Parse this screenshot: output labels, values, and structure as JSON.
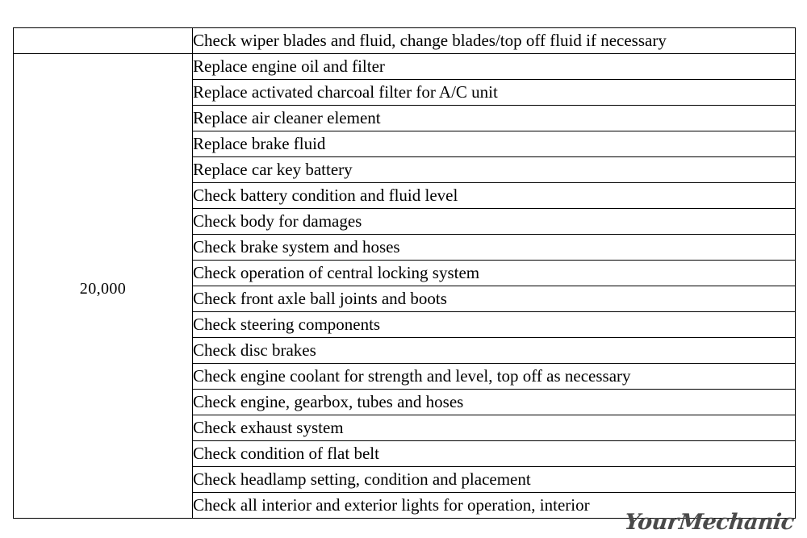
{
  "document": {
    "type": "maintenance-schedule-table",
    "background_color": "#ffffff",
    "border_color": "#000000",
    "text_color": "#000000"
  },
  "table": {
    "columns": [
      {
        "key": "mileage",
        "header": ""
      },
      {
        "key": "task",
        "header": ""
      }
    ],
    "groups": [
      {
        "mileage": "",
        "continued_from_previous": true,
        "tasks": [
          "Check wiper blades and fluid, change blades/top off fluid if necessary"
        ]
      },
      {
        "mileage": "20,000",
        "continued_from_previous": false,
        "tasks": [
          "Replace engine oil and filter",
          "Replace activated charcoal filter for A/C unit",
          "Replace air cleaner element",
          "Replace brake fluid",
          "Replace car key battery",
          "Check battery condition and fluid level",
          "Check body for damages",
          "Check brake system and hoses",
          "Check operation of central locking system",
          "Check front axle ball joints and boots",
          "Check steering components",
          "Check disc brakes",
          "Check engine coolant for strength and level, top off as necessary",
          "Check engine, gearbox, tubes and hoses",
          "Check exhaust system",
          "Check condition of flat belt",
          "Check headlamp setting, condition and placement",
          "Check all interior and exterior lights for operation, interior"
        ]
      }
    ]
  },
  "branding": {
    "logo_text_your": "Your",
    "logo_text_mechanic": "Mechanic",
    "logo_color": "#4a4a4a"
  }
}
